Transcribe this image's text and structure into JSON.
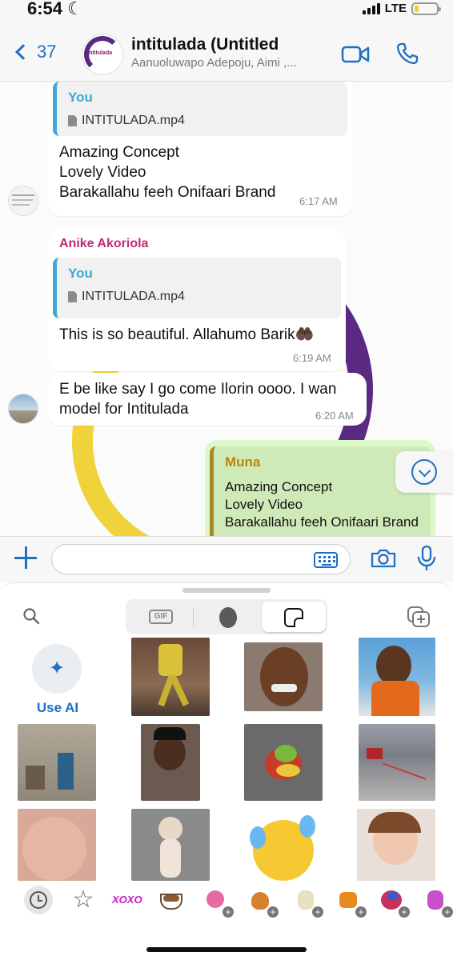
{
  "status_bar": {
    "time": "6:54",
    "network": "LTE",
    "battery_level": 0.2,
    "battery_color": "#f2d021"
  },
  "header": {
    "back_count": "37",
    "title": "intitulada (Untitled",
    "subtitle": "Aanuoluwapo Adepoju, Aimi ,...",
    "avatar_icon": "group-logo-icon",
    "video_call_icon": "video-camera-icon",
    "voice_call_icon": "phone-icon"
  },
  "messages": [
    {
      "quote_name": "You",
      "quote_file": "INTITULADA.mp4",
      "lines": [
        "Amazing Concept",
        "Lovely Video",
        "Barakallahu feeh Onifaari Brand"
      ],
      "time": "6:17 AM"
    },
    {
      "sender": "Anike Akoriola",
      "quote_name": "You",
      "quote_file": "INTITULADA.mp4",
      "lines": [
        "This is so beautiful. Allahumo Barik🤲🏿"
      ],
      "time": "6:19 AM"
    },
    {
      "lines": [
        "E be like say I go come Ilorin oooo. I wan",
        "model for Intitulada"
      ],
      "time": "6:20 AM"
    },
    {
      "quote_name": "Muna",
      "lines": [
        "Amazing Concept",
        "Lovely Video",
        "Barakallahu feeh Onifaari Brand"
      ]
    }
  ],
  "input": {
    "value": "",
    "placeholder": ""
  },
  "panel": {
    "tabs": [
      "GIF",
      "avatar",
      "stickers"
    ],
    "active_tab": "stickers",
    "ai_label": "Use AI",
    "bottom_bar": [
      "recent-icon",
      "favorites-star-icon",
      "XOXO",
      "coffee-sticker-pack",
      "pack-2",
      "pack-3",
      "pack-4",
      "pack-5",
      "pack-6",
      "pack-7"
    ],
    "xoxo_label": "XOXO"
  },
  "colors": {
    "accent": "#1f6fc2",
    "sender_name": "#c2297a",
    "quote_you": "#3fa9d6",
    "quote_muna": "#b8860b",
    "outgoing_bubble": "#dcf8c6"
  }
}
